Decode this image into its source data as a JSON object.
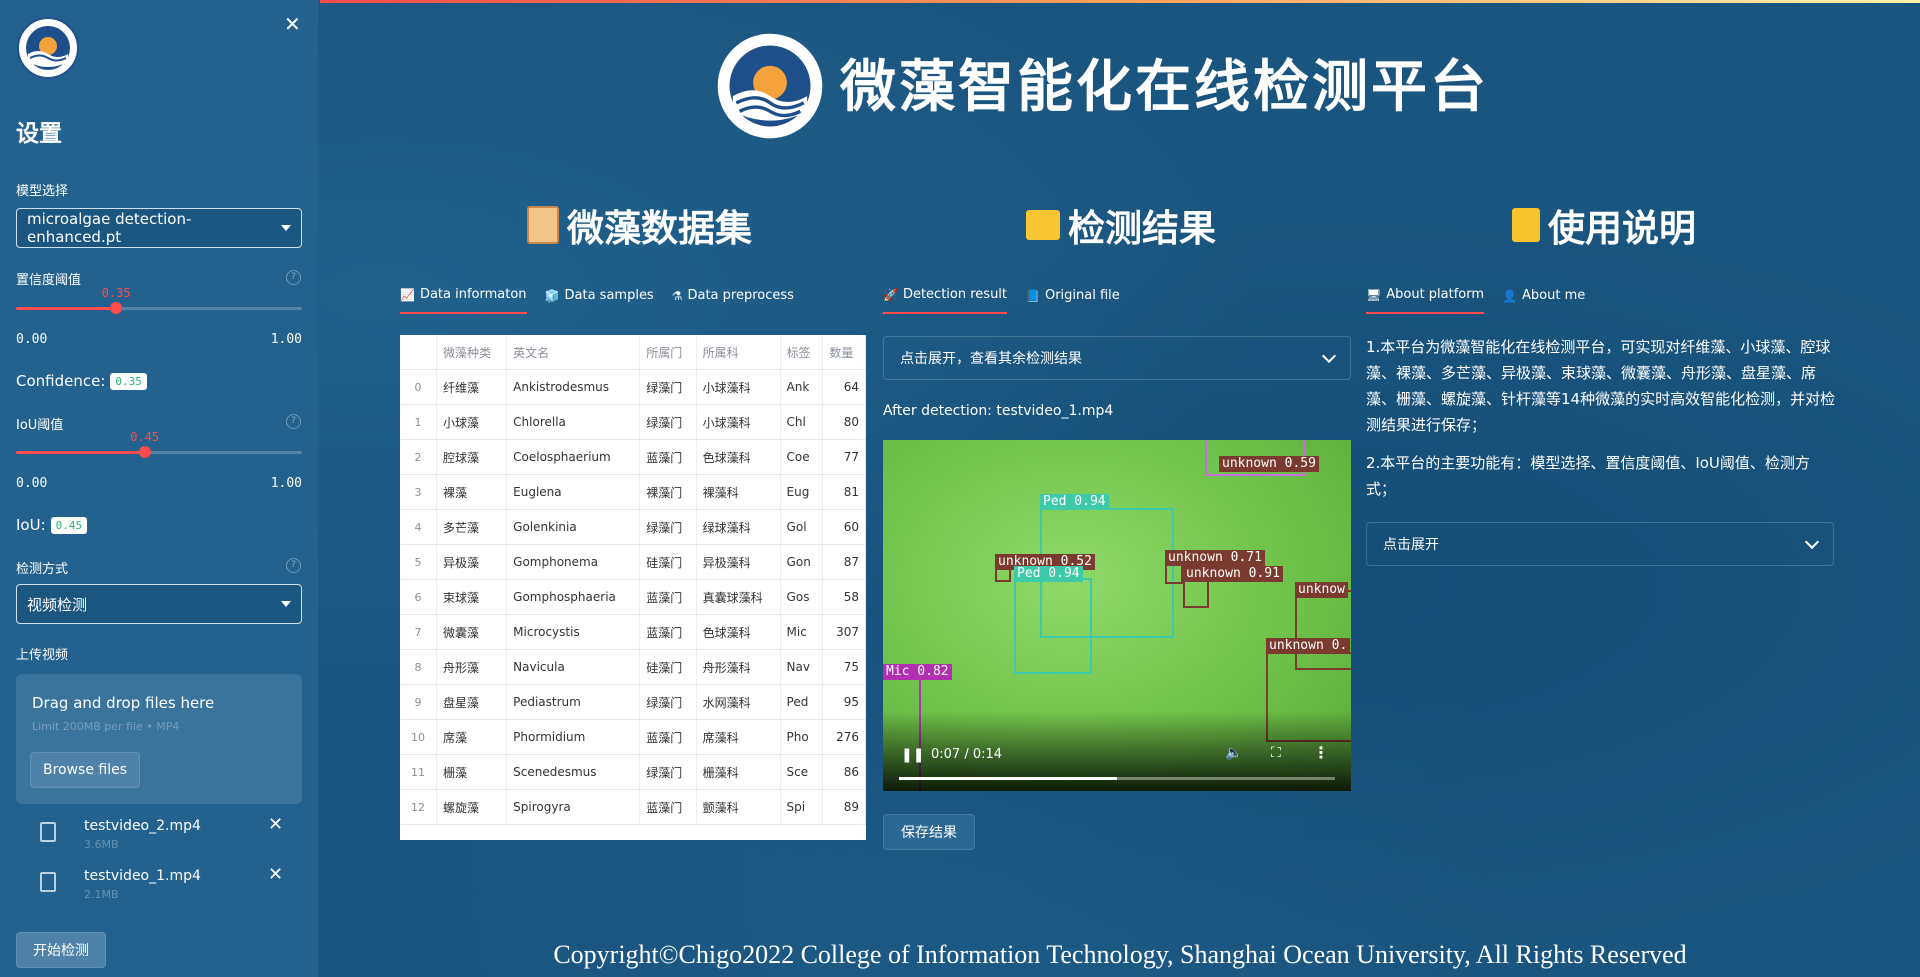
{
  "sidebar": {
    "title": "设置",
    "model_label": "模型选择",
    "model_value": "microalgae detection-enhanced.pt",
    "conf_label": "置信度阈值",
    "conf_value": 0.35,
    "conf_value_text": "0.35",
    "conf_min": "0.00",
    "conf_max": "1.00",
    "conf_readout_label": "Confidence:",
    "conf_readout": "0.35",
    "iou_label": "IoU阈值",
    "iou_value": 0.45,
    "iou_value_text": "0.45",
    "iou_min": "0.00",
    "iou_max": "1.00",
    "iou_readout_label": "IoU:",
    "iou_readout": "0.45",
    "mode_label": "检测方式",
    "mode_value": "视频检测",
    "upload_label": "上传视频",
    "dropzone_title": "Drag and drop files here",
    "dropzone_sub": "Limit 200MB per file • MP4",
    "browse_label": "Browse files",
    "files": [
      {
        "name": "testvideo_2.mp4",
        "size": "3.6MB"
      },
      {
        "name": "testvideo_1.mp4",
        "size": "2.1MB"
      }
    ],
    "start_label": "开始检测"
  },
  "header": {
    "title": "微藻智能化在线检测平台"
  },
  "sections": {
    "dataset": "微藻数据集",
    "detection": "检测结果",
    "usage": "使用说明"
  },
  "dataset_tabs": [
    "Data informaton",
    "Data samples",
    "Data preprocess"
  ],
  "detection_tabs": [
    "Detection result",
    "Original file"
  ],
  "usage_tabs": [
    "About platform",
    "About me"
  ],
  "table": {
    "headers": [
      "",
      "微藻种类",
      "英文名",
      "所属门",
      "所属科",
      "标签",
      "数量"
    ],
    "rows": [
      [
        "0",
        "纤维藻",
        "Ankistrodesmus",
        "绿藻门",
        "小球藻科",
        "Ank",
        "64"
      ],
      [
        "1",
        "小球藻",
        "Chlorella",
        "绿藻门",
        "小球藻科",
        "Chl",
        "80"
      ],
      [
        "2",
        "腔球藻",
        "Coelosphaerium",
        "蓝藻门",
        "色球藻科",
        "Coe",
        "77"
      ],
      [
        "3",
        "裸藻",
        "Euglena",
        "裸藻门",
        "裸藻科",
        "Eug",
        "81"
      ],
      [
        "4",
        "多芒藻",
        "Golenkinia",
        "绿藻门",
        "绿球藻科",
        "Gol",
        "60"
      ],
      [
        "5",
        "异极藻",
        "Gomphonema",
        "硅藻门",
        "异极藻科",
        "Gon",
        "87"
      ],
      [
        "6",
        "束球藻",
        "Gomphosphaeria",
        "蓝藻门",
        "真囊球藻科",
        "Gos",
        "58"
      ],
      [
        "7",
        "微囊藻",
        "Microcystis",
        "蓝藻门",
        "色球藻科",
        "Mic",
        "307"
      ],
      [
        "8",
        "舟形藻",
        "Navicula",
        "硅藻门",
        "舟形藻科",
        "Nav",
        "75"
      ],
      [
        "9",
        "盘星藻",
        "Pediastrum",
        "绿藻门",
        "水网藻科",
        "Ped",
        "95"
      ],
      [
        "10",
        "席藻",
        "Phormidium",
        "蓝藻门",
        "席藻科",
        "Pho",
        "276"
      ],
      [
        "11",
        "栅藻",
        "Scenedesmus",
        "绿藻门",
        "栅藻科",
        "Sce",
        "86"
      ],
      [
        "12",
        "螺旋藻",
        "Spirogyra",
        "蓝藻门",
        "颤藻科",
        "Spi",
        "89"
      ]
    ]
  },
  "detection": {
    "expander": "点击展开，查看其余检测结果",
    "caption": "After detection: testvideo_1.mp4",
    "labels": [
      "unknown 0.59",
      "Ped 0.94",
      "unknown 0.52",
      "Ped 0.94",
      "unknown 0.71",
      "unknown 0.91",
      "unknow",
      "unknown 0.",
      "Mic 0.82"
    ],
    "time": "0:07 / 0:14",
    "progress": 0.5,
    "save_label": "保存结果"
  },
  "usage": {
    "p1": "1.本平台为微藻智能化在线检测平台，可实现对纤维藻、小球藻、腔球藻、裸藻、多芒藻、异极藻、束球藻、微囊藻、舟形藻、盘星藻、席藻、栅藻、螺旋藻、针杆藻等14种微藻的实时高效智能化检测，并对检测结果进行保存；",
    "p2": "2.本平台的主要功能有：模型选择、置信度阈值、IoU阈值、检测方式；",
    "expander": "点击展开"
  },
  "footer": "Copyright©Chigo2022 College of Information Technology, Shanghai Ocean University, All Rights Reserved",
  "colors": {
    "accent": "#ff4b4b",
    "background": "#1a557f",
    "sidebar": "#23628f"
  }
}
